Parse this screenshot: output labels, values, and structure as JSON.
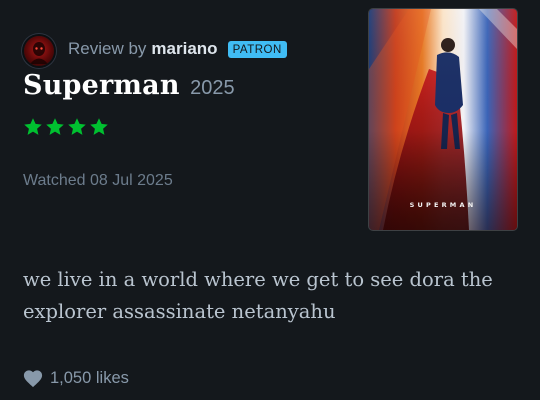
{
  "review": {
    "byline_prefix": "Review by",
    "username": "mariano",
    "badge": "PATRON",
    "film_title": "Superman",
    "film_year": "2025",
    "rating_stars": 4,
    "watched_text": "Watched 08 Jul 2025",
    "body_text": "we live in a world where we get to see dora the explorer assassinate netanyahu",
    "likes_text": "1,050 likes"
  },
  "poster": {
    "label": "SUPERMAN"
  },
  "icons": {
    "star": "star-icon",
    "like": "heart-icon",
    "avatar": "avatar-icon"
  },
  "colors": {
    "background": "#14181c",
    "star_green": "#00c030",
    "badge_blue": "#40bcf4",
    "username": "#dee5ec"
  }
}
